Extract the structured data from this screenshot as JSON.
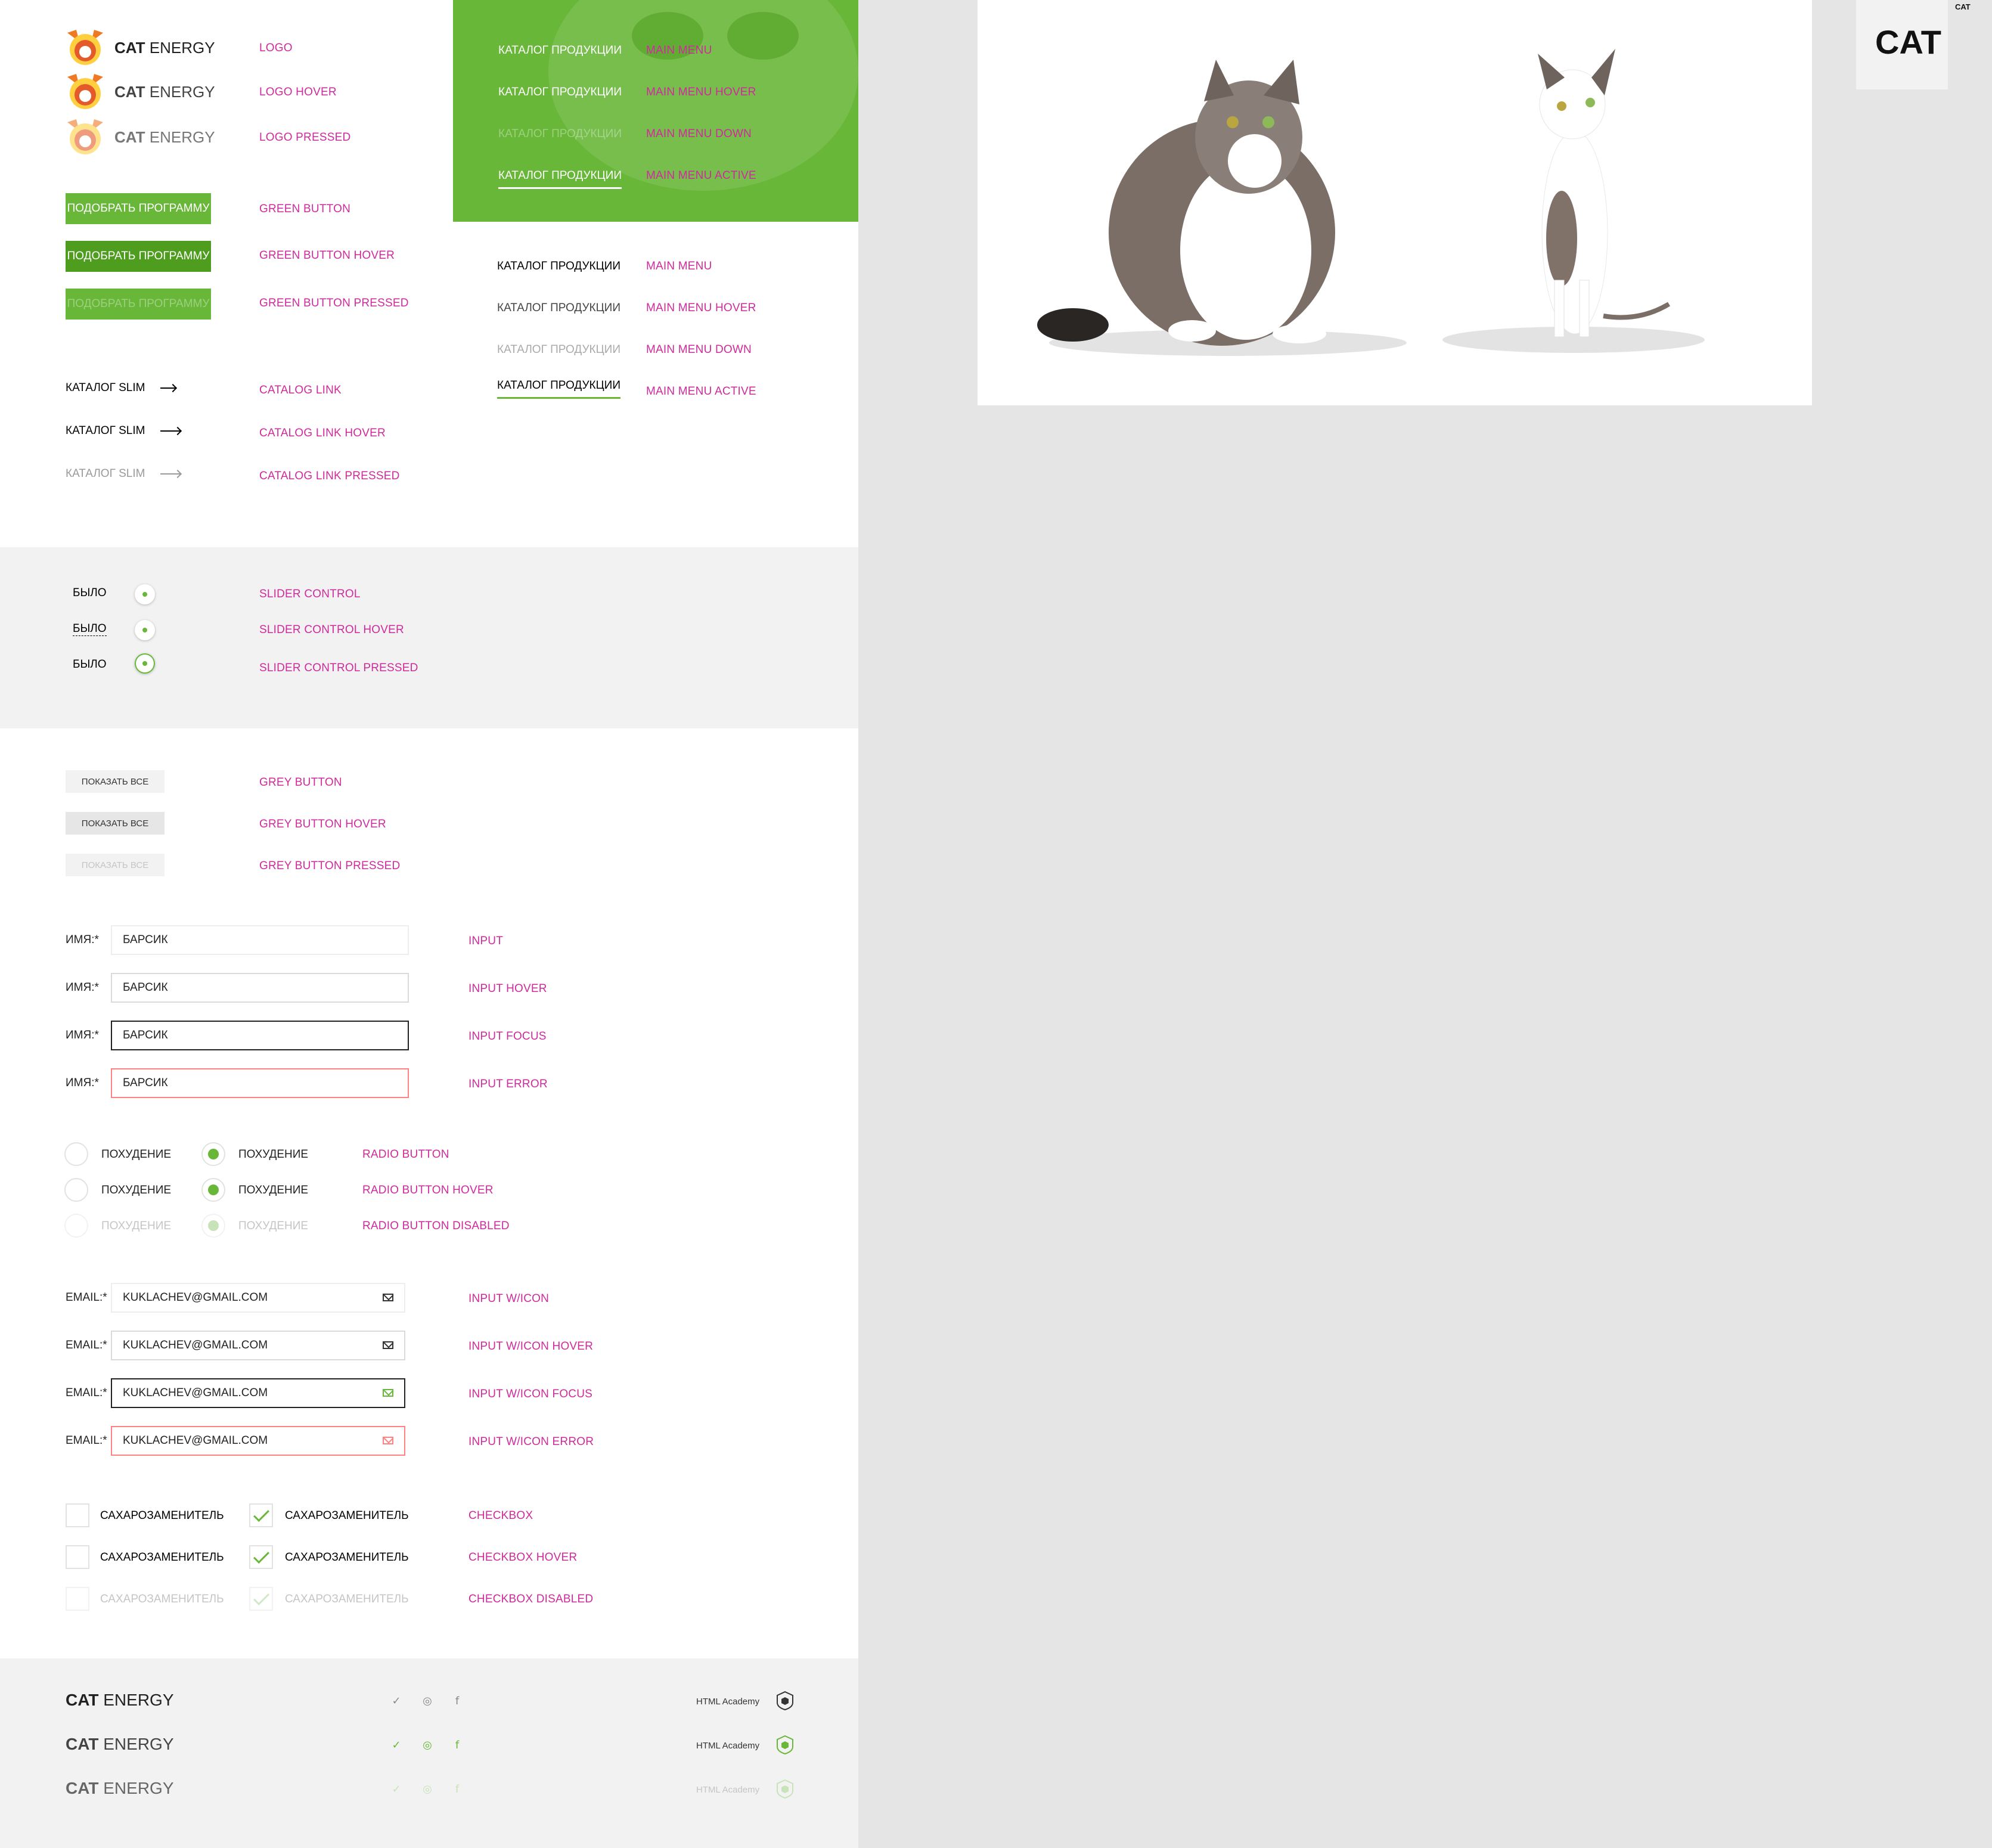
{
  "logo": {
    "brand_bold": "CAT",
    "brand_light": " ENERGY",
    "states": [
      "LOGO",
      "LOGO HOVER",
      "LOGO PRESSED"
    ]
  },
  "green_button": {
    "label": "ПОДОБРАТЬ ПРОГРАММУ",
    "states": [
      "GREEN BUTTON",
      "GREEN BUTTON HOVER",
      "GREEN BUTTON PRESSED"
    ]
  },
  "catalog_link": {
    "label": "КАТАЛОГ SLIM",
    "states": [
      "CATALOG LINK",
      "CATALOG LINK HOVER",
      "CATALOG LINK PRESSED"
    ]
  },
  "main_menu": {
    "label": "КАТАЛОГ ПРОДУКЦИИ",
    "states": [
      "MAIN MENU",
      "MAIN MENU HOVER",
      "MAIN MENU DOWN",
      "MAIN MENU ACTIVE"
    ]
  },
  "slider_control": {
    "label": "БЫЛО",
    "states": [
      "SLIDER CONTROL",
      "SLIDER CONTROL HOVER",
      "SLIDER CONTROL PRESSED"
    ]
  },
  "grey_button": {
    "label": "ПОКАЗАТЬ ВСЕ",
    "states": [
      "GREY BUTTON",
      "GREY BUTTON HOVER",
      "GREY BUTTON PRESSED"
    ]
  },
  "input": {
    "label": "ИМЯ:*",
    "value": "БАРСИК",
    "states": [
      "INPUT",
      "INPUT HOVER",
      "INPUT FOCUS",
      "INPUT ERROR"
    ]
  },
  "radio": {
    "label": "ПОХУДЕНИЕ",
    "states": [
      "RADIO BUTTON",
      "RADIO BUTTON HOVER",
      "RADIO BUTTON DISABLED"
    ]
  },
  "input_icon": {
    "label": "EMAIL:*",
    "value": "KUKLACHEV@GMAIL.COM",
    "icon": "mail-icon",
    "states": [
      "INPUT W/ICON",
      "INPUT W/ICON HOVER",
      "INPUT W/ICON FOCUS",
      "INPUT W/ICON ERROR"
    ]
  },
  "checkbox": {
    "label": "САХАРОЗАМЕНИТЕЛЬ",
    "states": [
      "CHECKBOX",
      "CHECKBOX HOVER",
      "CHECKBOX DISABLED"
    ]
  },
  "footer": {
    "brand_bold": "CAT",
    "brand_light": " ENERGY",
    "academy": "HTML Academy",
    "social_icons": [
      "vk-icon",
      "instagram-icon",
      "facebook-icon"
    ]
  },
  "badge": {
    "big": "CAT",
    "small": "CAT"
  },
  "colors": {
    "green": "#68b738",
    "green_hover": "#4e9d1f",
    "label_magenta": "#cf2a9c",
    "error": "#ff8282",
    "grey_bg": "#f2f2f2",
    "canvas": "#e5e5e5"
  }
}
